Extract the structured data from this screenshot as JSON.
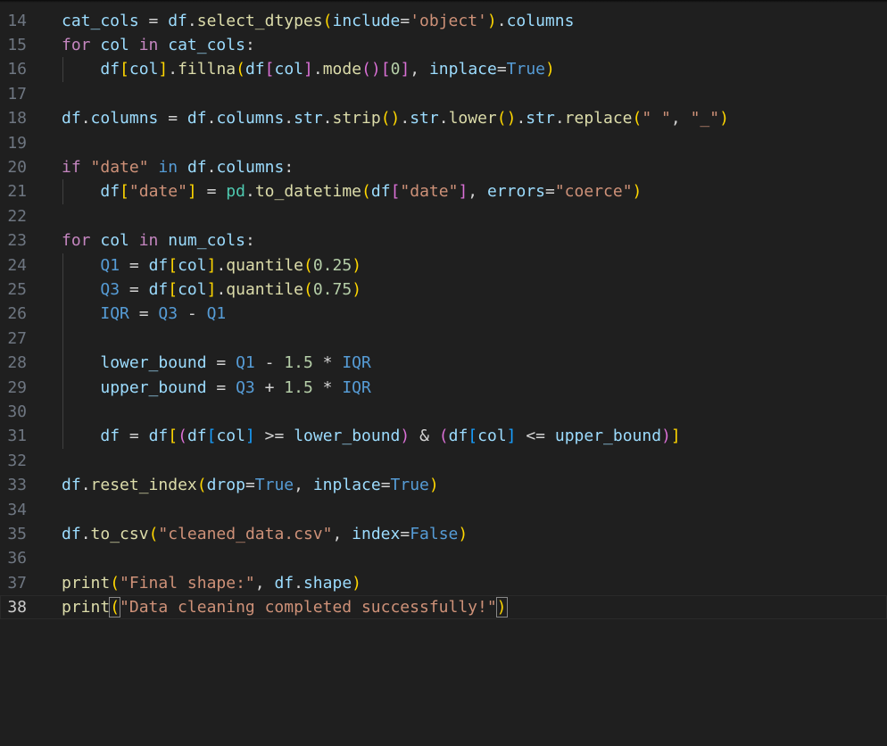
{
  "colors": {
    "background": "#1f1f1f",
    "line_number": "#6e7681",
    "line_number_active": "#cccccc",
    "keyword_control": "#c586c0",
    "keyword": "#569cd6",
    "variable": "#9cdcfe",
    "function": "#dcdcaa",
    "string": "#ce9178",
    "number": "#b5cea8",
    "operator": "#d4d4d4",
    "class": "#4ec9b0",
    "bracket1": "#ffd700",
    "bracket2": "#da70d6",
    "bracket3": "#179fff"
  },
  "editor": {
    "active_line": "38",
    "lines": [
      {
        "num": "14",
        "tokens": [
          [
            "cat_cols",
            "variable"
          ],
          [
            " = ",
            "operator"
          ],
          [
            "df",
            "variable"
          ],
          [
            ".",
            "operator"
          ],
          [
            "select_dtypes",
            "function"
          ],
          [
            "(",
            "bracket1"
          ],
          [
            "include",
            "variable"
          ],
          [
            "=",
            "operator"
          ],
          [
            "'object'",
            "string"
          ],
          [
            ")",
            "bracket1"
          ],
          [
            ".",
            "operator"
          ],
          [
            "columns",
            "variable"
          ]
        ]
      },
      {
        "num": "15",
        "tokens": [
          [
            "for",
            "keyword_control"
          ],
          [
            " ",
            "operator"
          ],
          [
            "col",
            "variable"
          ],
          [
            " ",
            "operator"
          ],
          [
            "in",
            "keyword_control"
          ],
          [
            " ",
            "operator"
          ],
          [
            "cat_cols",
            "variable"
          ],
          [
            ":",
            "operator"
          ]
        ]
      },
      {
        "num": "16",
        "tokens": [
          [
            "    ",
            "operator"
          ],
          [
            "df",
            "variable"
          ],
          [
            "[",
            "bracket1"
          ],
          [
            "col",
            "variable"
          ],
          [
            "]",
            "bracket1"
          ],
          [
            ".",
            "operator"
          ],
          [
            "fillna",
            "function"
          ],
          [
            "(",
            "bracket1"
          ],
          [
            "df",
            "variable"
          ],
          [
            "[",
            "bracket2"
          ],
          [
            "col",
            "variable"
          ],
          [
            "]",
            "bracket2"
          ],
          [
            ".",
            "operator"
          ],
          [
            "mode",
            "function"
          ],
          [
            "(",
            "bracket2"
          ],
          [
            ")",
            "bracket2"
          ],
          [
            "[",
            "bracket2"
          ],
          [
            "0",
            "number"
          ],
          [
            "]",
            "bracket2"
          ],
          [
            ", ",
            "operator"
          ],
          [
            "inplace",
            "variable"
          ],
          [
            "=",
            "operator"
          ],
          [
            "True",
            "keyword"
          ],
          [
            ")",
            "bracket1"
          ]
        ]
      },
      {
        "num": "17",
        "tokens": []
      },
      {
        "num": "18",
        "tokens": [
          [
            "df",
            "variable"
          ],
          [
            ".",
            "operator"
          ],
          [
            "columns",
            "variable"
          ],
          [
            " = ",
            "operator"
          ],
          [
            "df",
            "variable"
          ],
          [
            ".",
            "operator"
          ],
          [
            "columns",
            "variable"
          ],
          [
            ".",
            "operator"
          ],
          [
            "str",
            "variable"
          ],
          [
            ".",
            "operator"
          ],
          [
            "strip",
            "function"
          ],
          [
            "(",
            "bracket1"
          ],
          [
            ")",
            "bracket1"
          ],
          [
            ".",
            "operator"
          ],
          [
            "str",
            "variable"
          ],
          [
            ".",
            "operator"
          ],
          [
            "lower",
            "function"
          ],
          [
            "(",
            "bracket1"
          ],
          [
            ")",
            "bracket1"
          ],
          [
            ".",
            "operator"
          ],
          [
            "str",
            "variable"
          ],
          [
            ".",
            "operator"
          ],
          [
            "replace",
            "function"
          ],
          [
            "(",
            "bracket1"
          ],
          [
            "\" \"",
            "string"
          ],
          [
            ", ",
            "operator"
          ],
          [
            "\"_\"",
            "string"
          ],
          [
            ")",
            "bracket1"
          ]
        ]
      },
      {
        "num": "19",
        "tokens": []
      },
      {
        "num": "20",
        "tokens": [
          [
            "if",
            "keyword_control"
          ],
          [
            " ",
            "operator"
          ],
          [
            "\"date\"",
            "string"
          ],
          [
            " ",
            "operator"
          ],
          [
            "in",
            "keyword"
          ],
          [
            " ",
            "operator"
          ],
          [
            "df",
            "variable"
          ],
          [
            ".",
            "operator"
          ],
          [
            "columns",
            "variable"
          ],
          [
            ":",
            "operator"
          ]
        ]
      },
      {
        "num": "21",
        "tokens": [
          [
            "    ",
            "operator"
          ],
          [
            "df",
            "variable"
          ],
          [
            "[",
            "bracket1"
          ],
          [
            "\"date\"",
            "string"
          ],
          [
            "]",
            "bracket1"
          ],
          [
            " = ",
            "operator"
          ],
          [
            "pd",
            "class"
          ],
          [
            ".",
            "operator"
          ],
          [
            "to_datetime",
            "function"
          ],
          [
            "(",
            "bracket1"
          ],
          [
            "df",
            "variable"
          ],
          [
            "[",
            "bracket2"
          ],
          [
            "\"date\"",
            "string"
          ],
          [
            "]",
            "bracket2"
          ],
          [
            ", ",
            "operator"
          ],
          [
            "errors",
            "variable"
          ],
          [
            "=",
            "operator"
          ],
          [
            "\"coerce\"",
            "string"
          ],
          [
            ")",
            "bracket1"
          ]
        ]
      },
      {
        "num": "22",
        "tokens": []
      },
      {
        "num": "23",
        "tokens": [
          [
            "for",
            "keyword_control"
          ],
          [
            " ",
            "operator"
          ],
          [
            "col",
            "variable"
          ],
          [
            " ",
            "operator"
          ],
          [
            "in",
            "keyword_control"
          ],
          [
            " ",
            "operator"
          ],
          [
            "num_cols",
            "variable"
          ],
          [
            ":",
            "operator"
          ]
        ]
      },
      {
        "num": "24",
        "tokens": [
          [
            "    ",
            "operator"
          ],
          [
            "Q1",
            "keyword"
          ],
          [
            " = ",
            "operator"
          ],
          [
            "df",
            "variable"
          ],
          [
            "[",
            "bracket1"
          ],
          [
            "col",
            "variable"
          ],
          [
            "]",
            "bracket1"
          ],
          [
            ".",
            "operator"
          ],
          [
            "quantile",
            "function"
          ],
          [
            "(",
            "bracket1"
          ],
          [
            "0.25",
            "number"
          ],
          [
            ")",
            "bracket1"
          ]
        ]
      },
      {
        "num": "25",
        "tokens": [
          [
            "    ",
            "operator"
          ],
          [
            "Q3",
            "keyword"
          ],
          [
            " = ",
            "operator"
          ],
          [
            "df",
            "variable"
          ],
          [
            "[",
            "bracket1"
          ],
          [
            "col",
            "variable"
          ],
          [
            "]",
            "bracket1"
          ],
          [
            ".",
            "operator"
          ],
          [
            "quantile",
            "function"
          ],
          [
            "(",
            "bracket1"
          ],
          [
            "0.75",
            "number"
          ],
          [
            ")",
            "bracket1"
          ]
        ]
      },
      {
        "num": "26",
        "tokens": [
          [
            "    ",
            "operator"
          ],
          [
            "IQR",
            "keyword"
          ],
          [
            " = ",
            "operator"
          ],
          [
            "Q3",
            "keyword"
          ],
          [
            " - ",
            "operator"
          ],
          [
            "Q1",
            "keyword"
          ]
        ]
      },
      {
        "num": "27",
        "tokens": []
      },
      {
        "num": "28",
        "tokens": [
          [
            "    ",
            "operator"
          ],
          [
            "lower_bound",
            "variable"
          ],
          [
            " = ",
            "operator"
          ],
          [
            "Q1",
            "keyword"
          ],
          [
            " - ",
            "operator"
          ],
          [
            "1.5",
            "number"
          ],
          [
            " * ",
            "operator"
          ],
          [
            "IQR",
            "keyword"
          ]
        ]
      },
      {
        "num": "29",
        "tokens": [
          [
            "    ",
            "operator"
          ],
          [
            "upper_bound",
            "variable"
          ],
          [
            " = ",
            "operator"
          ],
          [
            "Q3",
            "keyword"
          ],
          [
            " + ",
            "operator"
          ],
          [
            "1.5",
            "number"
          ],
          [
            " * ",
            "operator"
          ],
          [
            "IQR",
            "keyword"
          ]
        ]
      },
      {
        "num": "30",
        "tokens": []
      },
      {
        "num": "31",
        "tokens": [
          [
            "    ",
            "operator"
          ],
          [
            "df",
            "variable"
          ],
          [
            " = ",
            "operator"
          ],
          [
            "df",
            "variable"
          ],
          [
            "[",
            "bracket1"
          ],
          [
            "(",
            "bracket2"
          ],
          [
            "df",
            "variable"
          ],
          [
            "[",
            "bracket3"
          ],
          [
            "col",
            "variable"
          ],
          [
            "]",
            "bracket3"
          ],
          [
            " >= ",
            "operator"
          ],
          [
            "lower_bound",
            "variable"
          ],
          [
            ")",
            "bracket2"
          ],
          [
            " & ",
            "operator"
          ],
          [
            "(",
            "bracket2"
          ],
          [
            "df",
            "variable"
          ],
          [
            "[",
            "bracket3"
          ],
          [
            "col",
            "variable"
          ],
          [
            "]",
            "bracket3"
          ],
          [
            " <= ",
            "operator"
          ],
          [
            "upper_bound",
            "variable"
          ],
          [
            ")",
            "bracket2"
          ],
          [
            "]",
            "bracket1"
          ]
        ]
      },
      {
        "num": "32",
        "tokens": []
      },
      {
        "num": "33",
        "tokens": [
          [
            "df",
            "variable"
          ],
          [
            ".",
            "operator"
          ],
          [
            "reset_index",
            "function"
          ],
          [
            "(",
            "bracket1"
          ],
          [
            "drop",
            "variable"
          ],
          [
            "=",
            "operator"
          ],
          [
            "True",
            "keyword"
          ],
          [
            ", ",
            "operator"
          ],
          [
            "inplace",
            "variable"
          ],
          [
            "=",
            "operator"
          ],
          [
            "True",
            "keyword"
          ],
          [
            ")",
            "bracket1"
          ]
        ]
      },
      {
        "num": "34",
        "tokens": []
      },
      {
        "num": "35",
        "tokens": [
          [
            "df",
            "variable"
          ],
          [
            ".",
            "operator"
          ],
          [
            "to_csv",
            "function"
          ],
          [
            "(",
            "bracket1"
          ],
          [
            "\"cleaned_data.csv\"",
            "string"
          ],
          [
            ", ",
            "operator"
          ],
          [
            "index",
            "variable"
          ],
          [
            "=",
            "operator"
          ],
          [
            "False",
            "keyword"
          ],
          [
            ")",
            "bracket1"
          ]
        ]
      },
      {
        "num": "36",
        "tokens": []
      },
      {
        "num": "37",
        "tokens": [
          [
            "print",
            "function"
          ],
          [
            "(",
            "bracket1"
          ],
          [
            "\"Final shape:\"",
            "string"
          ],
          [
            ", ",
            "operator"
          ],
          [
            "df",
            "variable"
          ],
          [
            ".",
            "operator"
          ],
          [
            "shape",
            "variable"
          ],
          [
            ")",
            "bracket1"
          ]
        ]
      },
      {
        "num": "38",
        "tokens": [
          [
            "print",
            "function"
          ],
          [
            "(",
            "bracket1"
          ],
          [
            "\"Data cleaning completed successfully!\"",
            "string"
          ],
          [
            ")",
            "bracket1"
          ]
        ]
      }
    ]
  }
}
